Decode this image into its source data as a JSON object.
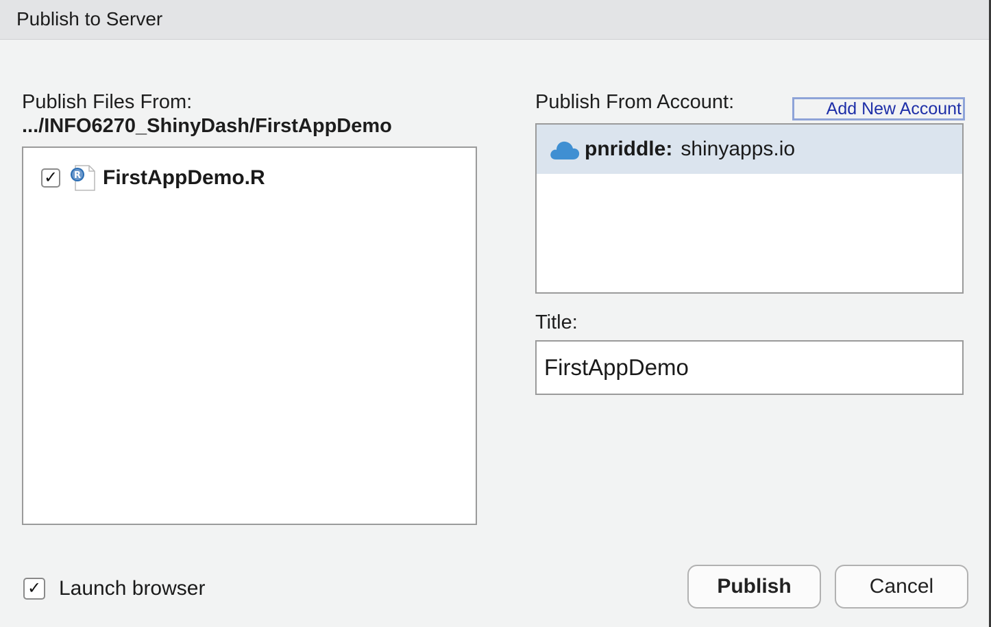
{
  "window": {
    "title": "Publish to Server"
  },
  "files": {
    "label": "Publish Files From:",
    "path": ".../INFO6270_ShinyDash/FirstAppDemo",
    "items": [
      {
        "name": "FirstAppDemo.R",
        "checked": true,
        "icon": "r-file-icon",
        "check_glyph": "✓"
      }
    ]
  },
  "account": {
    "label": "Publish From Account:",
    "add_button": "Add New Account",
    "items": [
      {
        "user": "pnriddle:",
        "server": "shinyapps.io",
        "icon": "cloud-icon",
        "selected": true
      }
    ]
  },
  "title_field": {
    "label": "Title:",
    "value": "FirstAppDemo"
  },
  "launch_browser": {
    "label": "Launch browser",
    "checked": true,
    "check_glyph": "✓"
  },
  "buttons": {
    "publish": "Publish",
    "cancel": "Cancel"
  },
  "colors": {
    "accent_link": "#1e2fa8",
    "selection": "#dbe4ee",
    "cloud": "#3f8fd2"
  }
}
